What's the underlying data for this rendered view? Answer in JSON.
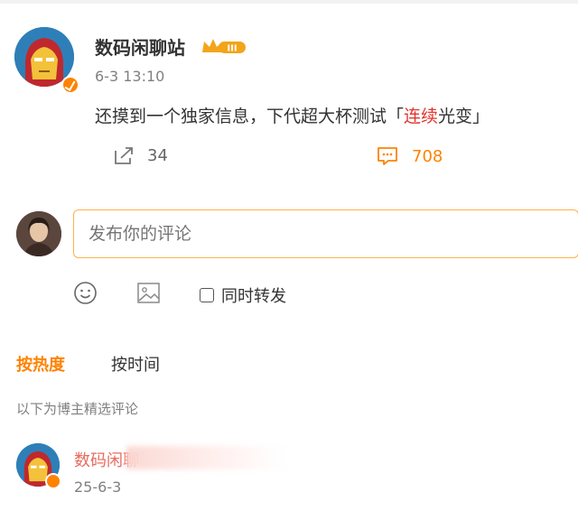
{
  "post": {
    "author": "数码闲聊站",
    "level_badge": "III",
    "time": "6-3 13:10",
    "text_before": "还摸到一个独家信息，下代超大杯测试「",
    "text_highlight": "连续",
    "text_after": "光变」",
    "share_count": "34",
    "comment_count": "708"
  },
  "composer": {
    "placeholder": "发布你的评论",
    "repost_label": "同时转发"
  },
  "tabs": [
    {
      "label": "按热度",
      "active": true
    },
    {
      "label": "按时间",
      "active": false
    }
  ],
  "section_note": "以下为博主精选评论",
  "comments": [
    {
      "author": "数码闲聊",
      "time": "25-6-3"
    }
  ],
  "colors": {
    "accent": "#ff8200",
    "highlight_red": "#e2352e",
    "muted": "#808080"
  },
  "icons": {
    "share": "share-icon",
    "comment": "comment-icon",
    "emoji": "emoji-icon",
    "image": "image-icon",
    "verified": "verified-icon",
    "crown": "crown-icon"
  }
}
